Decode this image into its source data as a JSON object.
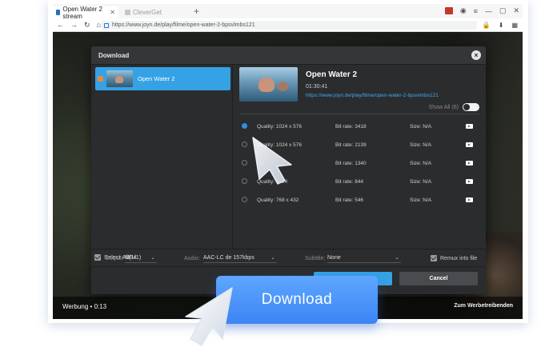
{
  "browser": {
    "tabs": [
      {
        "label": "Open Water 2 stream",
        "active": true
      },
      {
        "label": "CleverGet",
        "active": false
      }
    ],
    "new_tab": "+",
    "url": "https://www.joyn.de/play/filme/open-water-2-bpsvlmbs121"
  },
  "video_overlay": {
    "ad_label": "Werbung • 0:13",
    "advertiser_link": "Zum Werbetreibenden"
  },
  "dialog": {
    "title": "Download",
    "close": "×",
    "queue": [
      {
        "name": "Open Water 2",
        "checked": true
      }
    ],
    "select_all": "Select All(1/1)",
    "video": {
      "title": "Open Water 2",
      "duration": "01:30:41",
      "url": "https://www.joyn.de/play/filme/open-water-2-bpsvlmbs121"
    },
    "show_all": "Show All (6)",
    "qualities": [
      {
        "quality": "Quality: 1024 x 576",
        "bitrate": "Bit rate: 3418",
        "size": "Size: N/A",
        "selected": true
      },
      {
        "quality": "Quality: 1024 x 576",
        "bitrate": "Bit rate: 2139",
        "size": "Size: N/A",
        "selected": false
      },
      {
        "quality": "Qu",
        "bitrate": "Bit rate: 1340",
        "size": "Size: N/A",
        "selected": false
      },
      {
        "quality": "Quality: 1024",
        "bitrate": "Bit rate: 844",
        "size": "Size: N/A",
        "selected": false
      },
      {
        "quality": "Quality: 768 x 432",
        "bitrate": "Bit rate: 546",
        "size": "Size: N/A",
        "selected": false
      }
    ],
    "options": {
      "output_label": "Output:",
      "output_value": "MP4",
      "audio_label": "Audio:",
      "audio_value": "AAC-LC de 157kbps",
      "subtitle_label": "Subtitle:",
      "subtitle_value": "None",
      "remux_label": "Remux into file"
    },
    "cancel": "Cancel"
  },
  "overlay_button": "Download",
  "colors": {
    "accent": "#35a2e5",
    "overlay_button": "#3d84f5",
    "dialog_bg": "#2b2c2e"
  }
}
